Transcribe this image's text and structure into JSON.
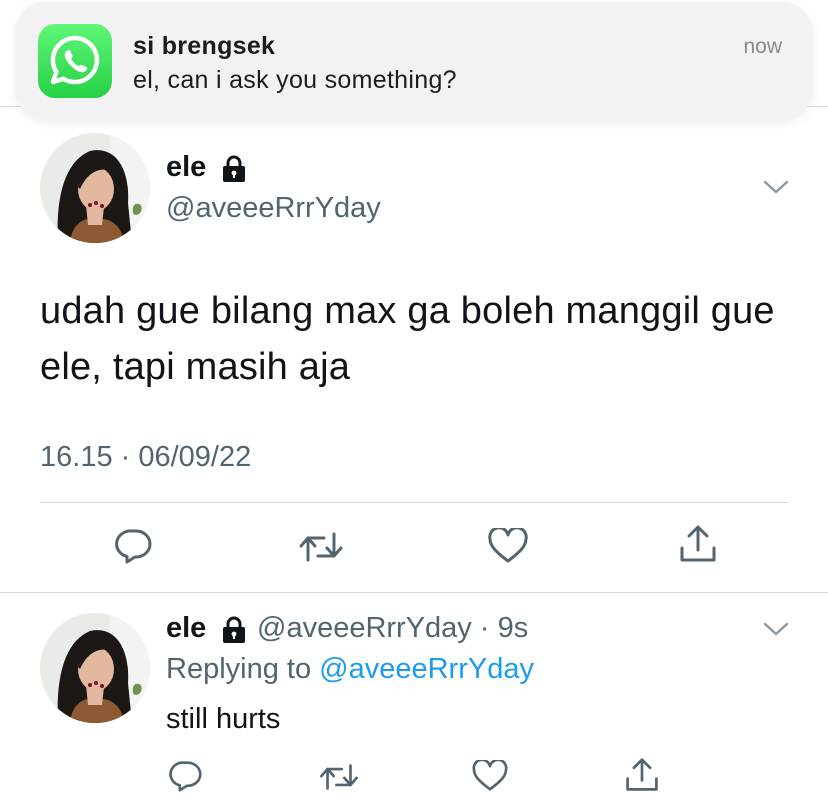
{
  "notification": {
    "app_icon": "whatsapp-icon",
    "title": "si brengsek",
    "body": "el, can i ask you something?",
    "time": "now",
    "brand_color": "#25d366"
  },
  "tweet": {
    "display_name": "ele",
    "protected_icon": "lock-icon",
    "handle": "@aveeeRrrYday",
    "text": "udah gue bilang max ga boleh manggil gue ele, tapi masih aja",
    "timestamp": "16.15 · 06/09/22",
    "actions": [
      "reply-icon",
      "retweet-icon",
      "like-icon",
      "share-icon"
    ]
  },
  "reply": {
    "display_name": "ele",
    "protected_icon": "lock-icon",
    "handle_time": "@aveeeRrrYday · 9s",
    "replying_prefix": "Replying to",
    "replying_to": "@aveeeRrrYday",
    "text": "still hurts",
    "actions": [
      "reply-icon",
      "retweet-icon",
      "like-icon",
      "share-icon"
    ]
  },
  "colors": {
    "text": "#0f1419",
    "secondary": "#536471",
    "link": "#1d9bf0",
    "divider": "#cfd9de"
  }
}
